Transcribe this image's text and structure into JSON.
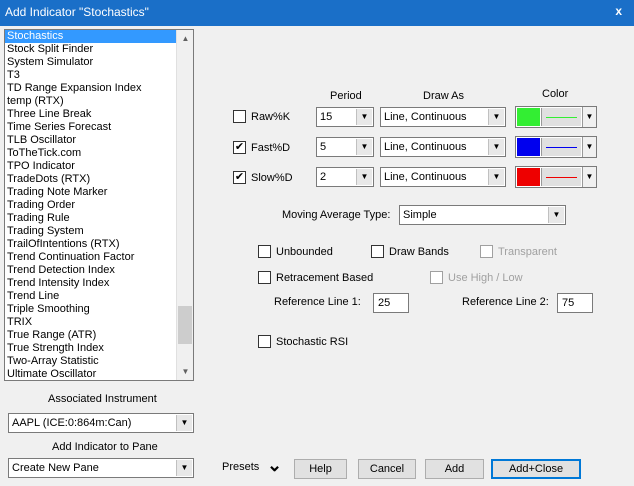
{
  "window": {
    "title": "Add Indicator \"Stochastics\"",
    "close_glyph": "x"
  },
  "indicator_list": {
    "items": [
      "Stochastics",
      "Stock Split Finder",
      "System Simulator",
      "T3",
      "TD Range Expansion Index",
      "temp (RTX)",
      "Three Line Break",
      "Time Series Forecast",
      "TLB Oscillator",
      "ToTheTick.com",
      "TPO Indicator",
      "TradeDots (RTX)",
      "Trading Note Marker",
      "Trading Order",
      "Trading Rule",
      "Trading System",
      "TrailOfIntentions (RTX)",
      "Trend Continuation Factor",
      "Trend Detection Index",
      "Trend Intensity Index",
      "Trend Line",
      "Triple Smoothing",
      "TRIX",
      "True Range (ATR)",
      "True Strength Index",
      "Two-Array Statistic",
      "Ultimate Oscillator"
    ],
    "selected_index": 0,
    "scroll_position": 0.93,
    "scroll_visible_fraction": 0.12,
    "scroll_up_glyph": "▲",
    "scroll_down_glyph": "▼"
  },
  "associated_instrument": {
    "label": "Associated Instrument",
    "value": "AAPL (ICE:0:864m:Can)"
  },
  "add_to_pane": {
    "label": "Add Indicator to Pane",
    "value": "Create New Pane"
  },
  "dropdown_glyph": "▼",
  "columns": {
    "period": "Period",
    "draw_as": "Draw As",
    "color": "Color"
  },
  "lines": [
    {
      "name": "Raw%K",
      "checked": "",
      "period": "15",
      "draw_as": "Line, Continuous",
      "color": "#33ee33"
    },
    {
      "name": "Fast%D",
      "checked": "✔",
      "period": "5",
      "draw_as": "Line, Continuous",
      "color": "#0000ee"
    },
    {
      "name": "Slow%D",
      "checked": "✔",
      "period": "2",
      "draw_as": "Line, Continuous",
      "color": "#ee0000"
    }
  ],
  "moving_average": {
    "label": "Moving Average Type:",
    "value": "Simple"
  },
  "options": {
    "unbounded": "Unbounded",
    "draw_bands": "Draw Bands",
    "transparent": "Transparent",
    "retracement_based": "Retracement Based",
    "use_high_low": "Use High / Low",
    "stochastic_rsi": "Stochastic RSI"
  },
  "reference_lines": {
    "line1_label": "Reference Line 1:",
    "line1_value": "25",
    "line2_label": "Reference Line 2:",
    "line2_value": "75"
  },
  "buttons": {
    "presets": "Presets",
    "presets_glyph": "⌄",
    "help": "Help",
    "cancel": "Cancel",
    "add": "Add",
    "add_close": "Add+Close"
  },
  "colors": {
    "titlebar": "#1a6fc8",
    "selection": "#3399ff",
    "background": "#f0f0f0"
  }
}
